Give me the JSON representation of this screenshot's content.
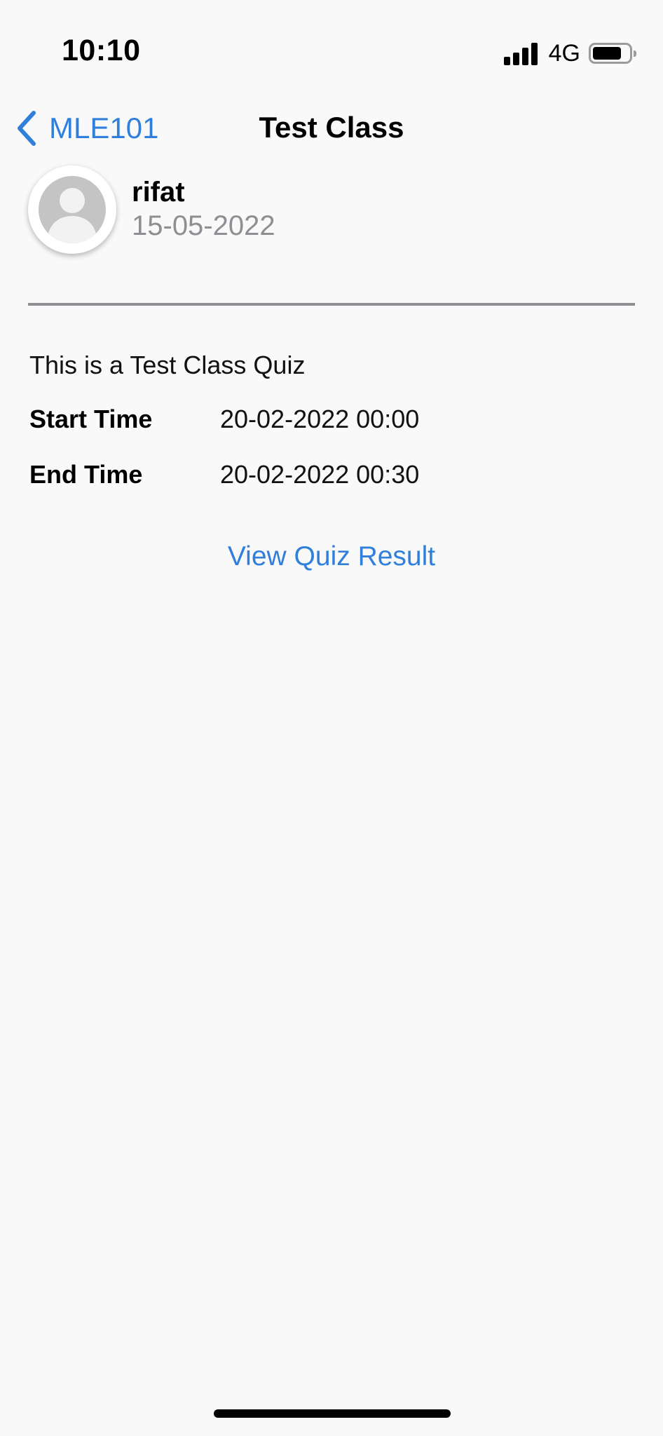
{
  "status_bar": {
    "time": "10:10",
    "network": "4G",
    "icons": [
      "signal-icon",
      "battery-icon"
    ]
  },
  "nav": {
    "back_label": "MLE101",
    "title": "Test Class",
    "back_icon": "chevron-left-icon",
    "accent_color": "#2f7fdb"
  },
  "post": {
    "user_name": "rifat",
    "date": "15-05-2022",
    "avatar_icon": "person-placeholder-icon"
  },
  "quiz": {
    "description": "This is a Test Class Quiz",
    "start_label": "Start Time",
    "start_value": "20-02-2022 00:00",
    "end_label": "End Time",
    "end_value": "20-02-2022 00:30",
    "view_result_label": "View Quiz Result"
  }
}
